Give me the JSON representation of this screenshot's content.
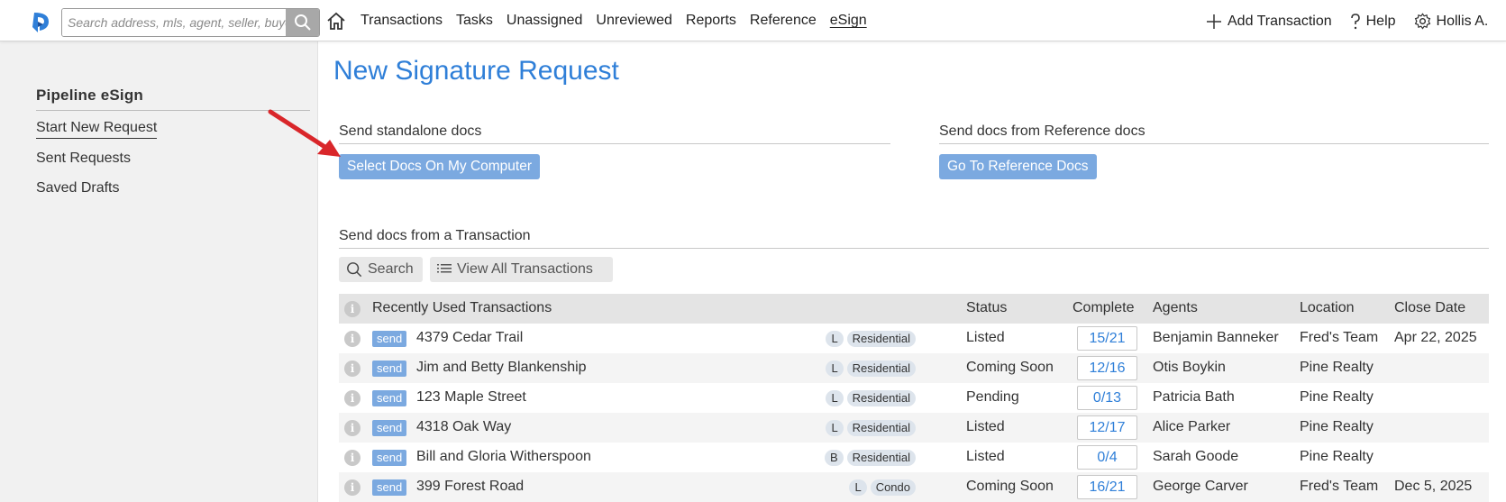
{
  "topbar": {
    "search_placeholder": "Search address, mls, agent, seller, buyer",
    "nav": [
      "Transactions",
      "Tasks",
      "Unassigned",
      "Unreviewed",
      "Reports",
      "Reference",
      "eSign"
    ],
    "active_nav": "eSign",
    "add_transaction": "Add Transaction",
    "help": "Help",
    "user": "Hollis A."
  },
  "sidebar": {
    "title": "Pipeline eSign",
    "links": [
      "Start New Request",
      "Sent Requests",
      "Saved Drafts"
    ]
  },
  "main": {
    "title": "New Signature Request",
    "standalone": {
      "heading": "Send standalone docs",
      "button": "Select Docs On My Computer"
    },
    "reference": {
      "heading": "Send docs from Reference docs",
      "button": "Go To Reference Docs"
    },
    "transaction": {
      "heading": "Send docs from a Transaction",
      "search_button": "Search",
      "view_all_button": "View All Transactions"
    }
  },
  "table": {
    "headers": {
      "name": "Recently Used Transactions",
      "status": "Status",
      "complete": "Complete",
      "agents": "Agents",
      "location": "Location",
      "close_date": "Close Date"
    },
    "send_label": "send",
    "info_glyph": "i",
    "rows": [
      {
        "name": "4379 Cedar Trail",
        "side": "L",
        "type": "Residential",
        "status": "Listed",
        "complete": "15/21",
        "agent": "Benjamin Banneker",
        "location": "Fred's Team",
        "close_date": "Apr 22, 2025"
      },
      {
        "name": "Jim and Betty Blankenship",
        "side": "L",
        "type": "Residential",
        "status": "Coming Soon",
        "complete": "12/16",
        "agent": "Otis Boykin",
        "location": "Pine Realty",
        "close_date": ""
      },
      {
        "name": "123 Maple Street",
        "side": "L",
        "type": "Residential",
        "status": "Pending",
        "complete": "0/13",
        "agent": "Patricia Bath",
        "location": "Pine Realty",
        "close_date": ""
      },
      {
        "name": "4318 Oak Way",
        "side": "L",
        "type": "Residential",
        "status": "Listed",
        "complete": "12/17",
        "agent": "Alice Parker",
        "location": "Pine Realty",
        "close_date": ""
      },
      {
        "name": "Bill and Gloria Witherspoon",
        "side": "B",
        "type": "Residential",
        "status": "Listed",
        "complete": "0/4",
        "agent": "Sarah Goode",
        "location": "Pine Realty",
        "close_date": ""
      },
      {
        "name": "399 Forest Road",
        "side": "L",
        "type": "Condo",
        "status": "Coming Soon",
        "complete": "16/21",
        "agent": "George Carver",
        "location": "Fred's Team",
        "close_date": "Dec 5, 2025"
      }
    ]
  },
  "colors": {
    "accent": "#2f7fd8",
    "button": "#7ba9e0",
    "arrow": "#d9262a",
    "sidebar_bg": "#f1f1f1"
  },
  "icons": [
    "logo-icon",
    "search-icon",
    "home-icon",
    "plus-icon",
    "question-icon",
    "gear-icon",
    "list-icon",
    "info-icon",
    "annotation-arrow"
  ]
}
